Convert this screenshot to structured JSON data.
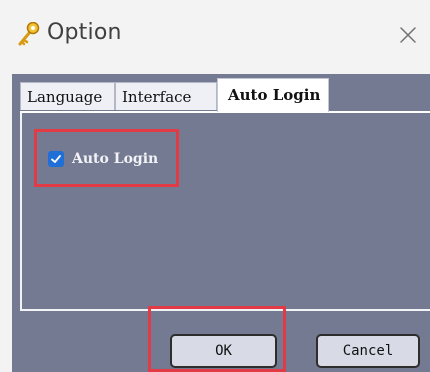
{
  "window": {
    "title": "Option",
    "icon": "key-icon",
    "close_icon": "close-icon"
  },
  "tabs": [
    {
      "label": "Language",
      "active": false
    },
    {
      "label": "Interface",
      "active": false
    },
    {
      "label": "Auto Login",
      "active": true
    }
  ],
  "auto_login": {
    "checkbox_label": "Auto Login",
    "checked": true
  },
  "buttons": {
    "ok_label": "OK",
    "cancel_label": "Cancel"
  },
  "colors": {
    "highlight": "#e33b46",
    "checkbox": "#1f6fd6",
    "panel_background": "#757a93"
  }
}
